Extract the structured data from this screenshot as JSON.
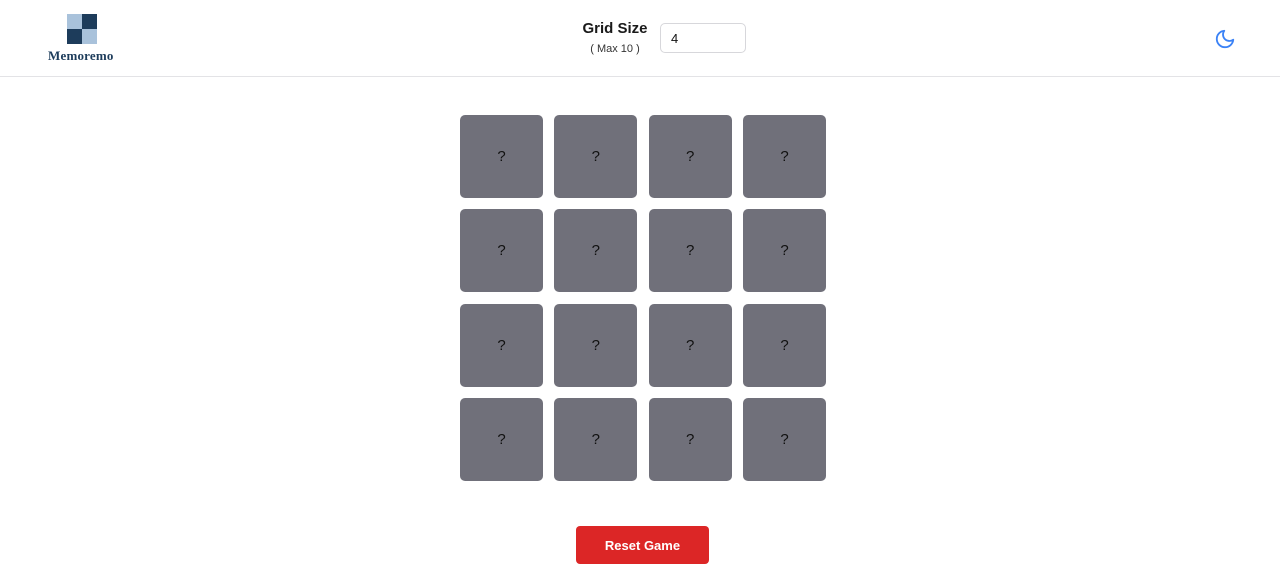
{
  "header": {
    "logo_text": "Memoremo",
    "grid_size_label": "Grid Size",
    "grid_size_hint": "( Max 10 )",
    "grid_size_value": "4",
    "theme_icon": "moon-icon"
  },
  "board": {
    "size": 4,
    "cards": [
      {
        "label": "?"
      },
      {
        "label": "?"
      },
      {
        "label": "?"
      },
      {
        "label": "?"
      },
      {
        "label": "?"
      },
      {
        "label": "?"
      },
      {
        "label": "?"
      },
      {
        "label": "?"
      },
      {
        "label": "?"
      },
      {
        "label": "?"
      },
      {
        "label": "?"
      },
      {
        "label": "?"
      },
      {
        "label": "?"
      },
      {
        "label": "?"
      },
      {
        "label": "?"
      },
      {
        "label": "?"
      }
    ]
  },
  "actions": {
    "reset_label": "Reset Game"
  },
  "colors": {
    "card": "#70707a",
    "reset": "#dc2626",
    "logo_dark": "#1d3c5b",
    "logo_light": "#a9c2db",
    "theme_icon": "#3b82f6"
  }
}
